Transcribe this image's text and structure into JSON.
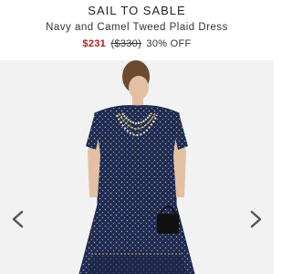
{
  "product": {
    "brand": "SAIL TO SABLE",
    "name": "Navy and Camel Tweed Plaid Dress",
    "sale_price": "$231",
    "original_price": "($330)",
    "discount": "30% OFF"
  },
  "gallery": {
    "prev_icon": "chevron-left-icon",
    "next_icon": "chevron-right-icon",
    "image_subject": "dress-photo"
  },
  "colors": {
    "sale": "#b71c1c",
    "background": "#f2f2f2",
    "dress": "#1f2a4a"
  }
}
